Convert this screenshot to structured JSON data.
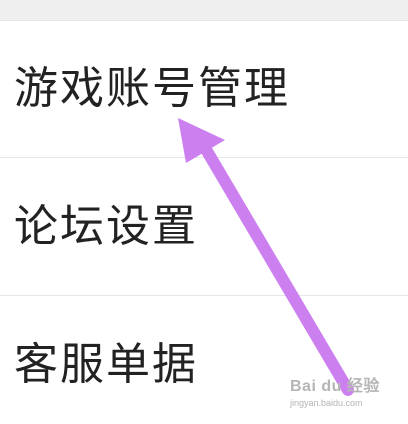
{
  "menu": {
    "items": [
      {
        "label": "游戏账号管理"
      },
      {
        "label": "论坛设置"
      },
      {
        "label": "客服单据"
      }
    ]
  },
  "annotation": {
    "arrow_color": "#cc80f0",
    "arrow_icon": "arrow-up-left-icon"
  },
  "watermark": {
    "logo": "Bai du 经验",
    "url": "jingyan.baidu.com"
  }
}
